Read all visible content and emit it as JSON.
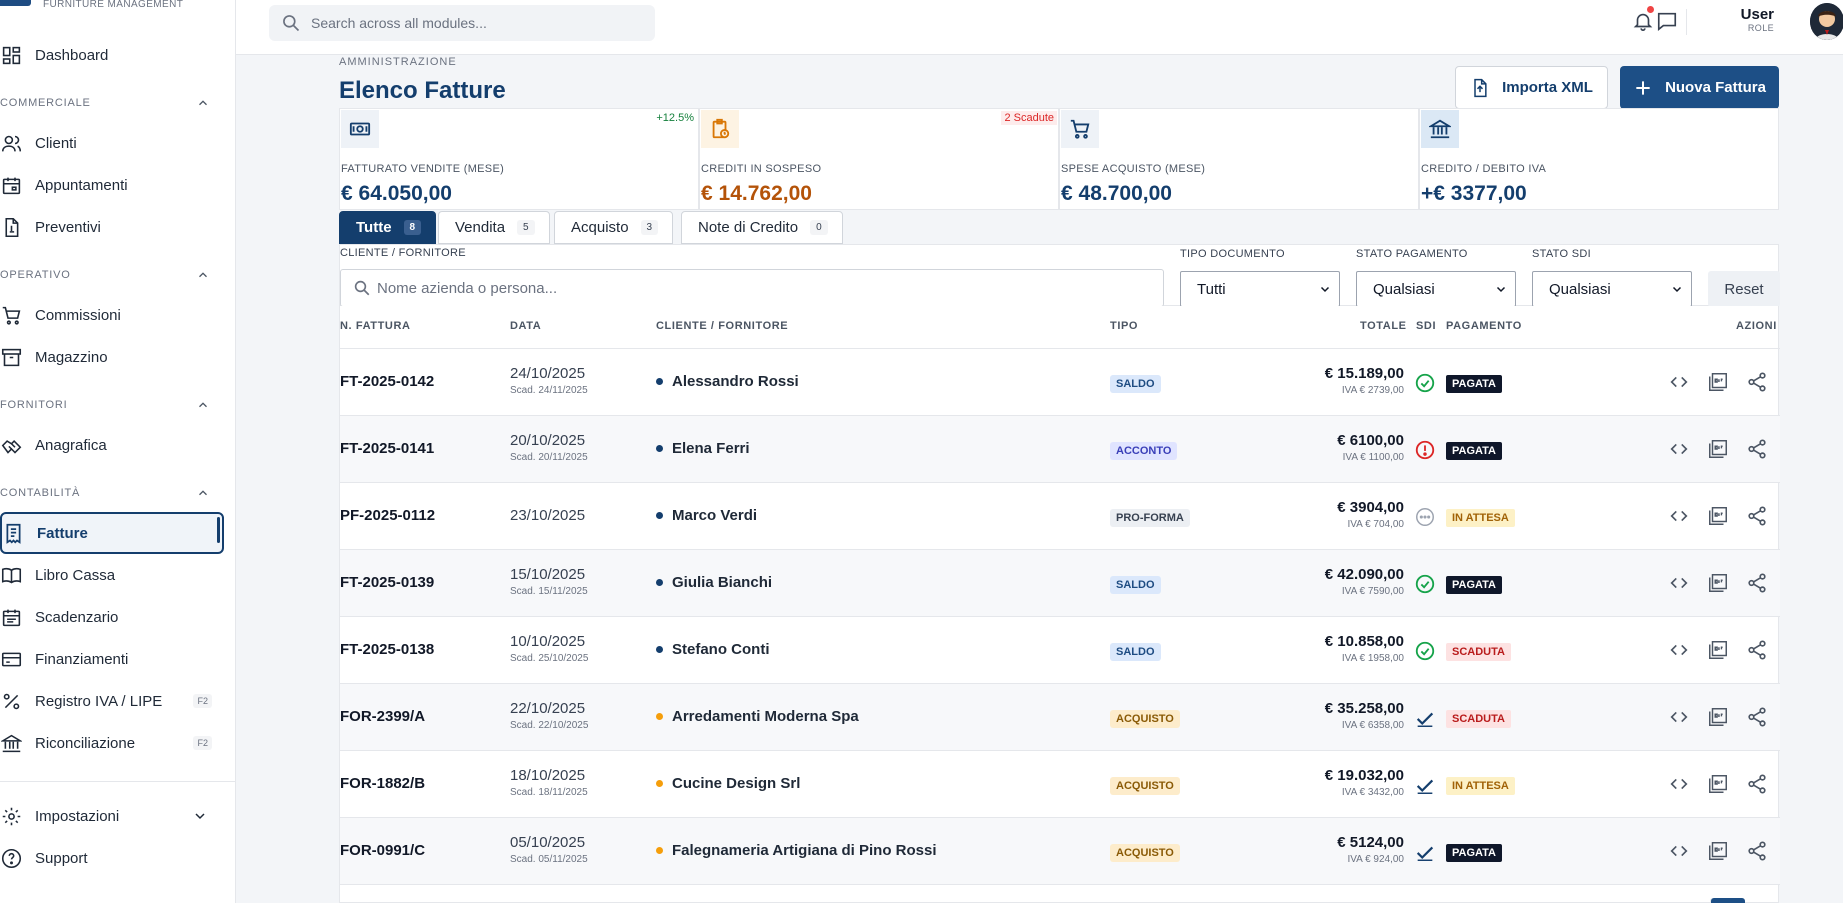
{
  "brand": {
    "subtitle": "FURNITURE MANAGEMENT"
  },
  "sidebar": {
    "dashboard": "Dashboard",
    "groups": {
      "commerciale": "COMMERCIALE",
      "operativo": "OPERATIVO",
      "fornitori": "FORNITORI",
      "contabilita": "CONTABILITÀ"
    },
    "items": {
      "clienti": "Clienti",
      "appuntamenti": "Appuntamenti",
      "preventivi": "Preventivi",
      "commissioni": "Commissioni",
      "magazzino": "Magazzino",
      "anagrafica": "Anagrafica",
      "fatture": "Fatture",
      "libro_cassa": "Libro Cassa",
      "scadenzario": "Scadenzario",
      "finanziamenti": "Finanziamenti",
      "registro_iva": "Registro IVA / LIPE",
      "riconciliazione": "Riconciliazione",
      "impostazioni": "Impostazioni",
      "support": "Support"
    },
    "shortcuts": {
      "registro_iva": "F2",
      "riconciliazione": "F2"
    }
  },
  "header": {
    "search_placeholder": "Search across all modules...",
    "user_name": "User",
    "user_role": "ROLE"
  },
  "page": {
    "breadcrumb": "AMMINISTRAZIONE",
    "title": "Elenco Fatture",
    "import_label": "Importa XML",
    "new_label": "Nuova Fattura"
  },
  "kpis": [
    {
      "label": "FATTURATO VENDITE (MESE)",
      "value": "€ 64.050,00",
      "badge": "+12.5%",
      "color": "#143e6d",
      "icon": "money-icon"
    },
    {
      "label": "CREDITI IN SOSPESO",
      "value": "€ 14.762,00",
      "badge": "2 Scadute",
      "color": "#b45309",
      "icon": "clipboard-clock-icon"
    },
    {
      "label": "SPESE ACQUISTO (MESE)",
      "value": "€ 48.700,00",
      "badge": "",
      "color": "#143e6d",
      "icon": "cart-icon"
    },
    {
      "label": "CREDITO / DEBITO IVA",
      "value": "+€ 3377,00",
      "badge": "",
      "color": "#143e6d",
      "icon": "bank-icon"
    }
  ],
  "tabs": [
    {
      "label": "Tutte",
      "count": "8"
    },
    {
      "label": "Vendita",
      "count": "5"
    },
    {
      "label": "Acquisto",
      "count": "3"
    },
    {
      "label": "Note di Credito",
      "count": "0"
    }
  ],
  "filters": {
    "client_label": "CLIENTE / FORNITORE",
    "client_placeholder": "Nome azienda o persona...",
    "doc_type_label": "TIPO DOCUMENTO",
    "doc_type_value": "Tutti",
    "pay_state_label": "STATO PAGAMENTO",
    "pay_state_value": "Qualsiasi",
    "sdi_state_label": "STATO SDI",
    "sdi_state_value": "Qualsiasi",
    "reset_label": "Reset"
  },
  "table": {
    "headers": {
      "number": "N. FATTURA",
      "date": "DATA",
      "client": "CLIENTE / FORNITORE",
      "type": "TIPO",
      "total": "TOTALE",
      "sdi": "SDI",
      "payment": "PAGAMENTO",
      "actions": "AZIONI"
    },
    "rows": [
      {
        "number": "FT-2025-0142",
        "date": "24/10/2025",
        "due": "Scad. 24/11/2025",
        "client": "Alessandro Rossi",
        "kind": "sale",
        "type": "SALDO",
        "total": "€ 15.189,00",
        "iva": "IVA € 2739,00",
        "sdi": "ok",
        "payment": "PAGATA"
      },
      {
        "number": "FT-2025-0141",
        "date": "20/10/2025",
        "due": "Scad. 20/11/2025",
        "client": "Elena Ferri",
        "kind": "sale",
        "type": "ACCONTO",
        "total": "€ 6100,00",
        "iva": "IVA € 1100,00",
        "sdi": "error",
        "payment": "PAGATA"
      },
      {
        "number": "PF-2025-0112",
        "date": "23/10/2025",
        "due": "",
        "client": "Marco Verdi",
        "kind": "sale",
        "type": "PRO-FORMA",
        "total": "€ 3904,00",
        "iva": "IVA € 704,00",
        "sdi": "pending",
        "payment": "IN ATTESA"
      },
      {
        "number": "FT-2025-0139",
        "date": "15/10/2025",
        "due": "Scad. 15/11/2025",
        "client": "Giulia Bianchi",
        "kind": "sale",
        "type": "SALDO",
        "total": "€ 42.090,00",
        "iva": "IVA € 7590,00",
        "sdi": "ok",
        "payment": "PAGATA"
      },
      {
        "number": "FT-2025-0138",
        "date": "10/10/2025",
        "due": "Scad. 25/10/2025",
        "client": "Stefano Conti",
        "kind": "sale",
        "type": "SALDO",
        "total": "€ 10.858,00",
        "iva": "IVA € 1958,00",
        "sdi": "ok",
        "payment": "SCADUTA"
      },
      {
        "number": "FOR-2399/A",
        "date": "22/10/2025",
        "due": "Scad. 22/10/2025",
        "client": "Arredamenti Moderna Spa",
        "kind": "buy",
        "type": "ACQUISTO",
        "total": "€ 35.258,00",
        "iva": "IVA € 6358,00",
        "sdi": "check",
        "payment": "SCADUTA"
      },
      {
        "number": "FOR-1882/B",
        "date": "18/10/2025",
        "due": "Scad. 18/11/2025",
        "client": "Cucine Design Srl",
        "kind": "buy",
        "type": "ACQUISTO",
        "total": "€ 19.032,00",
        "iva": "IVA € 3432,00",
        "sdi": "check",
        "payment": "IN ATTESA"
      },
      {
        "number": "FOR-0991/C",
        "date": "05/10/2025",
        "due": "Scad. 05/11/2025",
        "client": "Falegnameria Artigiana di Pino Rossi",
        "kind": "buy",
        "type": "ACQUISTO",
        "total": "€ 5124,00",
        "iva": "IVA € 924,00",
        "sdi": "check",
        "payment": "PAGATA"
      }
    ]
  }
}
